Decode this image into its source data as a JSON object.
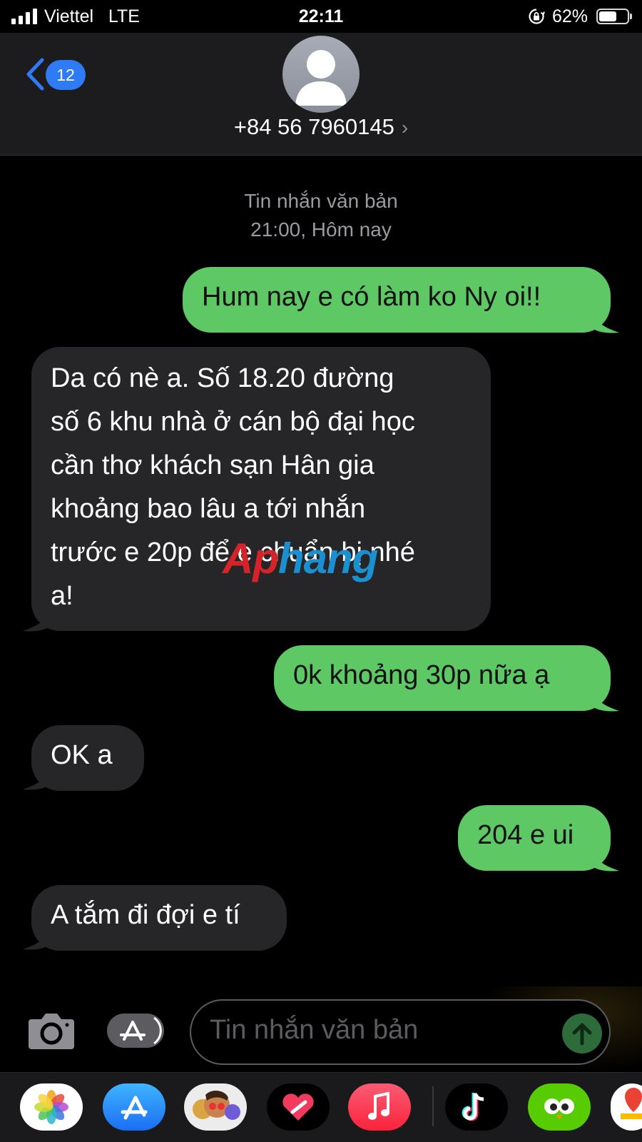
{
  "status_bar": {
    "carrier": "Viettel",
    "network": "LTE",
    "time": "22:11",
    "battery_text": "62%",
    "battery_level": 0.62,
    "signal_icon": "signal-bars-icon",
    "orientation_lock_icon": "orientation-lock-icon"
  },
  "header": {
    "unread_count": "12",
    "contact": "+84 56 7960145",
    "detail_chevron": "›"
  },
  "conversation": {
    "stamp_title": "Tin nhắn văn bản",
    "stamp_time": "21:00, Hôm nay",
    "messages": [
      {
        "direction": "sent",
        "text": "Hum nay e có làm ko Ny oi!!"
      },
      {
        "direction": "received",
        "lines": [
          "Da có nè a. Số 18.20 đường",
          "số 6 khu nhà ở cán bộ đại học",
          "cần thơ khách sạn Hân gia",
          "khoảng bao lâu a tới nhắn",
          "trước e 20p để e chuẩn bị nhé",
          "a!"
        ]
      },
      {
        "direction": "sent",
        "text": "0k khoảng 30p nữa ạ"
      },
      {
        "direction": "received",
        "text": "OK a"
      },
      {
        "direction": "sent",
        "text": "204 e ui"
      },
      {
        "direction": "received",
        "text": "A tắm đi đợi e tí"
      }
    ]
  },
  "watermark": {
    "part1": "Ap",
    "part2": "hang"
  },
  "composer": {
    "placeholder": "Tin nhắn văn bản"
  },
  "app_drawer": [
    {
      "name": "photos-app-icon"
    },
    {
      "name": "app-store-app-icon"
    },
    {
      "name": "memoji-app-icon"
    },
    {
      "name": "digital-touch-app-icon"
    },
    {
      "name": "music-app-icon"
    },
    {
      "name": "tiktok-app-icon"
    },
    {
      "name": "duolingo-app-icon"
    },
    {
      "name": "maps-app-icon"
    }
  ],
  "colors": {
    "sent_bubble": "#5ec864",
    "received_bubble": "#262628",
    "accent_blue": "#2f7bf5",
    "background": "#000000"
  }
}
